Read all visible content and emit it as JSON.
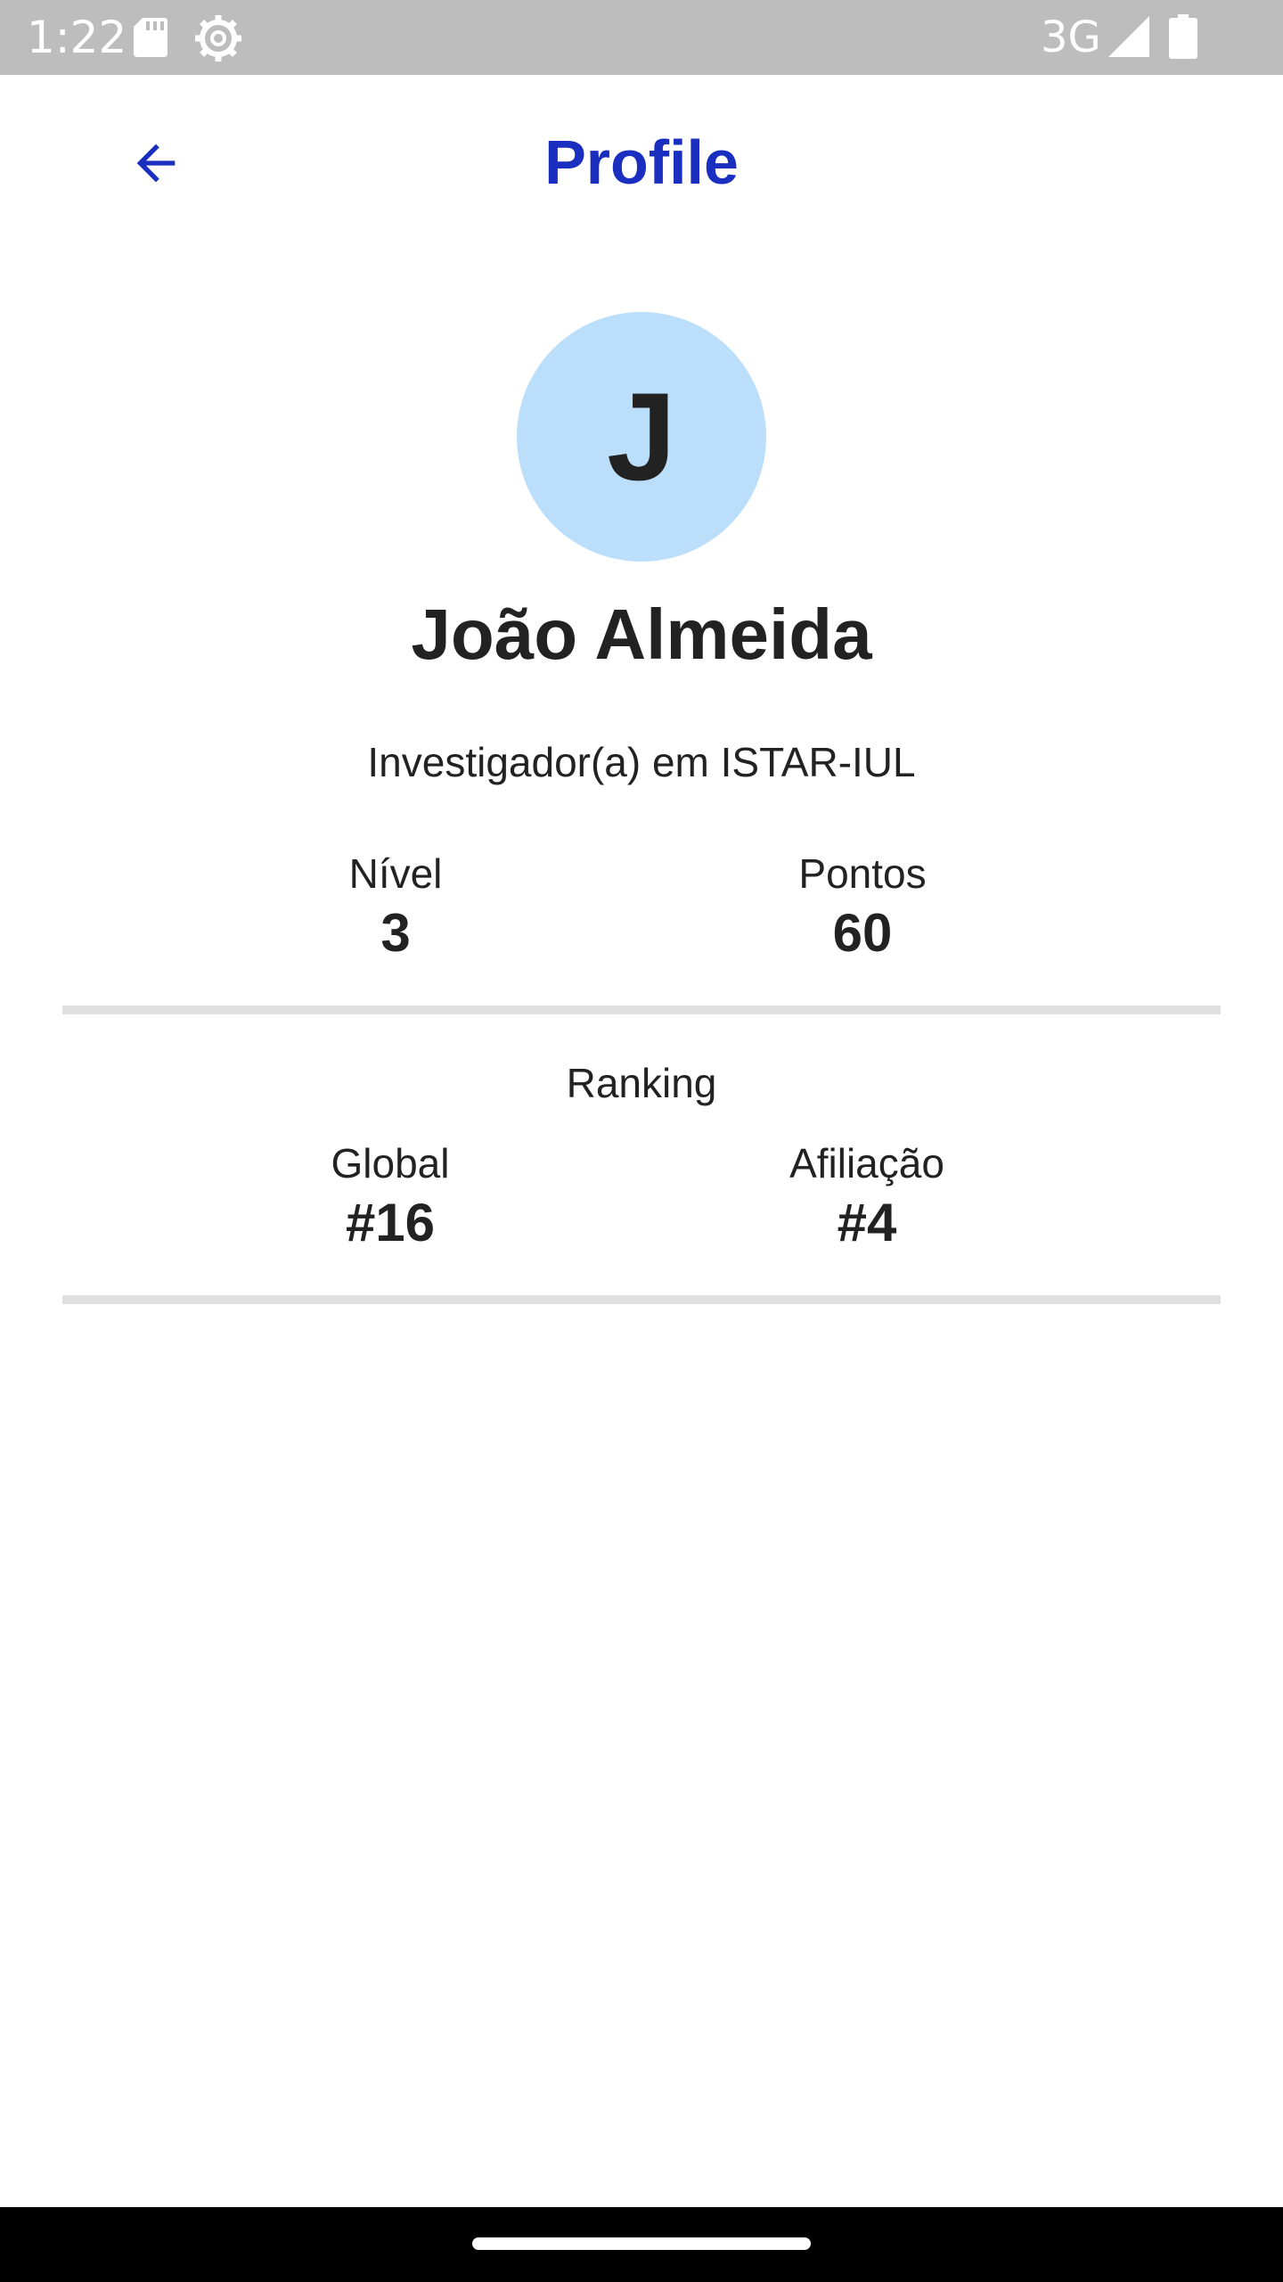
{
  "status_bar": {
    "time": "1:22",
    "network": "3G",
    "icons": [
      "sd-card-icon",
      "settings-gear-icon",
      "signal-icon",
      "battery-icon"
    ]
  },
  "app_bar": {
    "title": "Profile",
    "back_icon": "arrow-left-icon",
    "accent_color": "#1a2fbf"
  },
  "profile": {
    "avatar_initial": "J",
    "avatar_color": "#bbdefb",
    "name": "João Almeida",
    "affiliation": "Investigador(a) em ISTAR-IUL"
  },
  "stats": {
    "level_label": "Nível",
    "level_value": "3",
    "points_label": "Pontos",
    "points_value": "60"
  },
  "ranking": {
    "title": "Ranking",
    "global_label": "Global",
    "global_value": "#16",
    "affiliation_label": "Afiliação",
    "affiliation_value": "#4"
  }
}
